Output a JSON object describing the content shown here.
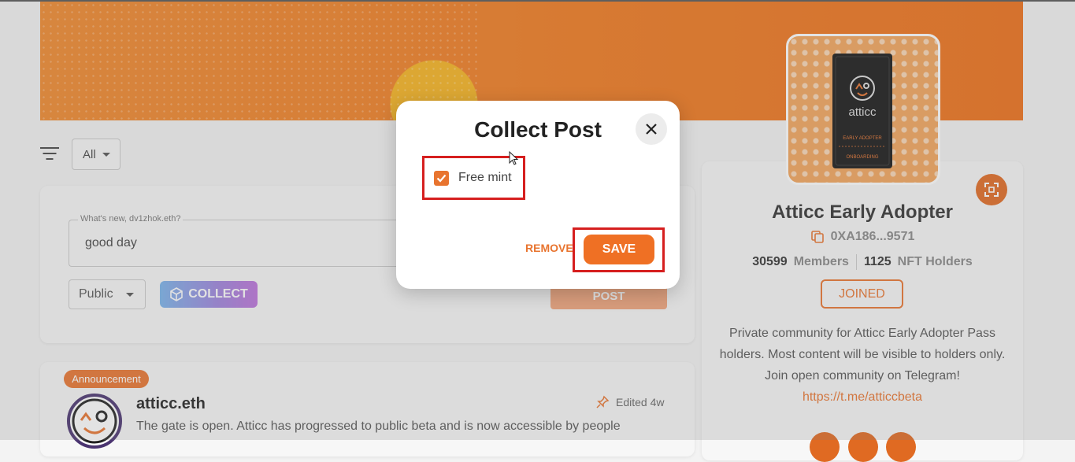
{
  "feed": {
    "filter_value": "All",
    "composer": {
      "legend": "What's new, dv1zhok.eth?",
      "value": "good day",
      "visibility": "Public",
      "collect_label": "COLLECT",
      "post_label": "POST"
    },
    "post": {
      "badge": "Announcement",
      "author": "atticc.eth",
      "edited": "Edited 4w",
      "body": "The gate is open. Atticc has progressed to public beta and is now accessible by people"
    }
  },
  "community": {
    "logo_text": "atticc",
    "ticket_line1": "EARLY ADOPTER",
    "ticket_line2": "ONBOARDING",
    "title": "Atticc Early Adopter",
    "address": "0XA186...9571",
    "members_count": "30599",
    "members_label": "Members",
    "holders_count": "1125",
    "holders_label": "NFT Holders",
    "joined_label": "JOINED",
    "description": "Private community for Atticc Early Adopter Pass holders. Most content will be visible to holders only. Join open community on Telegram!",
    "link": "https://t.me/atticcbeta"
  },
  "modal": {
    "title": "Collect Post",
    "free_mint_label": "Free mint",
    "free_mint_checked": true,
    "remove_label": "REMOVE",
    "save_label": "SAVE"
  },
  "colors": {
    "accent": "#e8742f",
    "highlight": "#d61f1f"
  }
}
